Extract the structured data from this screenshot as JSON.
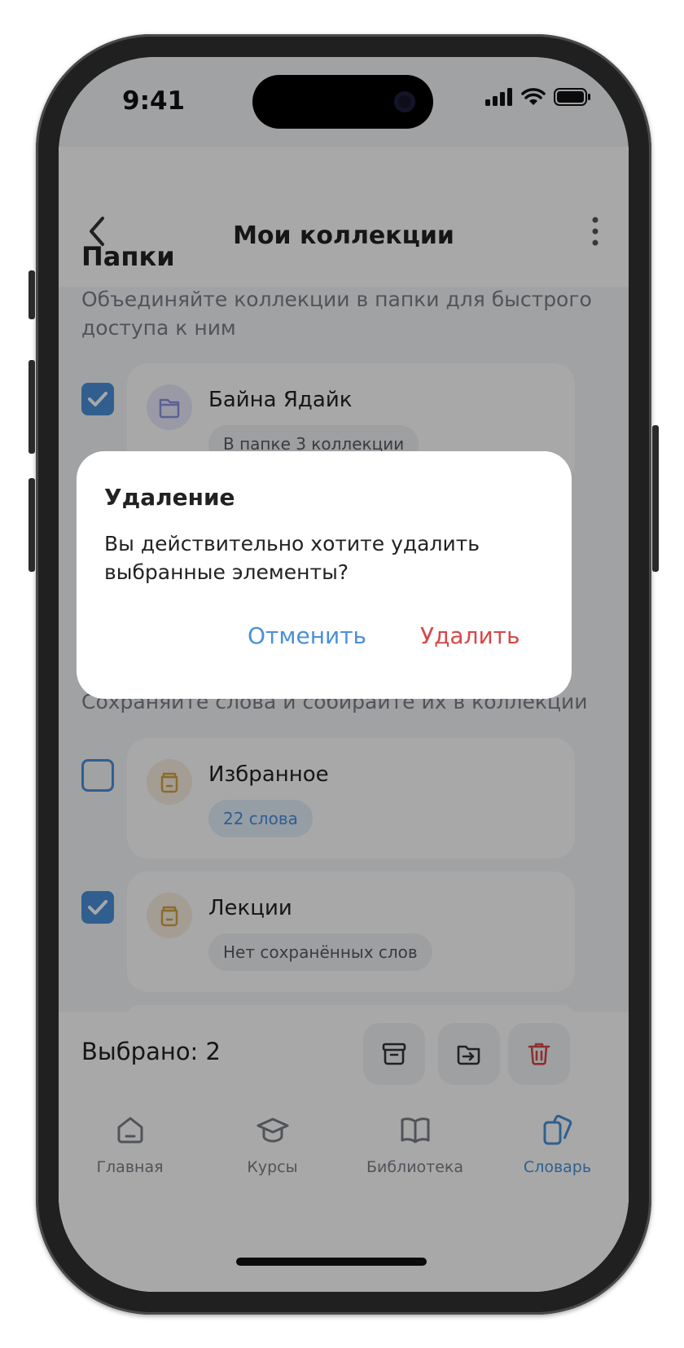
{
  "status_bar": {
    "time": "9:41"
  },
  "nav": {
    "title": "Мои коллекции"
  },
  "folders": {
    "title": "Папки",
    "description": "Объединяйте коллекции в папки для быстрого доступа к ним",
    "items": [
      {
        "title": "Байна Ядайк",
        "badge": "В папке 3 коллекции",
        "checked": true
      }
    ]
  },
  "collections": {
    "description": "Сохраняйте слова и собирайте их в коллекции",
    "items": [
      {
        "title": "Избранное",
        "badge": "22 слова",
        "checked": false
      },
      {
        "title": "Лекции",
        "badge": "Нет сохранённых слов",
        "checked": true
      }
    ]
  },
  "action_bar": {
    "selected": "Выбрано: 2",
    "icons": [
      "archive-icon",
      "move-to-folder-icon",
      "trash-icon"
    ]
  },
  "tabs": [
    {
      "label": "Главная",
      "icon": "home-icon",
      "active": false
    },
    {
      "label": "Курсы",
      "icon": "graduation-cap-icon",
      "active": false
    },
    {
      "label": "Библиотека",
      "icon": "book-icon",
      "active": false
    },
    {
      "label": "Словарь",
      "icon": "cards-icon",
      "active": true
    }
  ],
  "dialog": {
    "title": "Удаление",
    "message": "Вы действительно хотите удалить выбранные элементы?",
    "cancel": "Отменить",
    "confirm": "Удалить"
  },
  "colors": {
    "accent": "#4a90d9",
    "danger": "#d64848",
    "folder_icon": "#8b93dd",
    "collection_icon": "#d6a246"
  }
}
